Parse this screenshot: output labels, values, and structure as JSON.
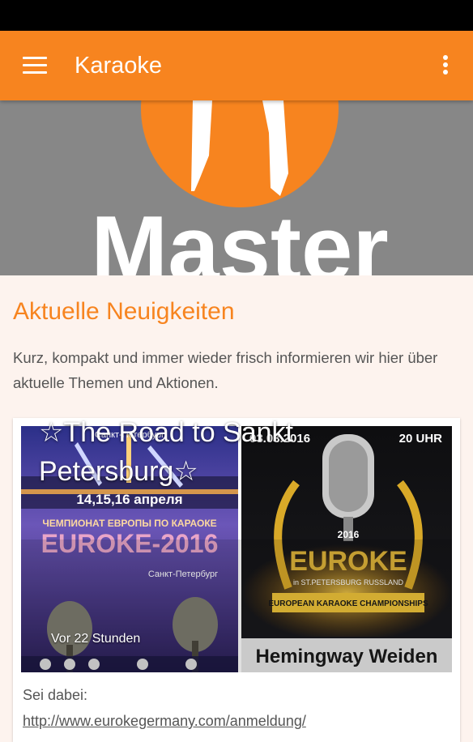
{
  "app_bar": {
    "title": "Karaoke",
    "menu_icon": "hamburger-menu-icon",
    "overflow_icon": "more-vert-icon",
    "color": "#f7841f"
  },
  "hero": {
    "logo_text": "Master"
  },
  "news": {
    "heading": "Aktuelle Neuigkeiten",
    "intro": "Kurz, kompakt und immer wieder frisch informieren wir hier über aktuelle Themen und Aktionen."
  },
  "card": {
    "title": "☆The Road to Sankt Petersburg☆",
    "time": "Vor 22 Stunden",
    "body_line": "Sei dabei:",
    "link": "http://www.eurokegermany.com/anmeldung/",
    "poster_left": {
      "city": "Санкт-Петербург",
      "dates": "14,15,16 апреля",
      "championship": "ЧЕМПИОНАТ ЕВРОПЫ ПО КАРАОКЕ",
      "event": "EUROKE-2016",
      "subtitle": "Санкт-Петербург"
    },
    "poster_right": {
      "date": "03.03.2016",
      "time": "20 UHR",
      "year": "2016",
      "event": "EUROKE",
      "location": "in ST.PETERSBURG RUSSLAND",
      "banner": "EUROPEAN KARAOKE CHAMPIONSHIPS",
      "venue": "Hemingway Weiden"
    }
  }
}
